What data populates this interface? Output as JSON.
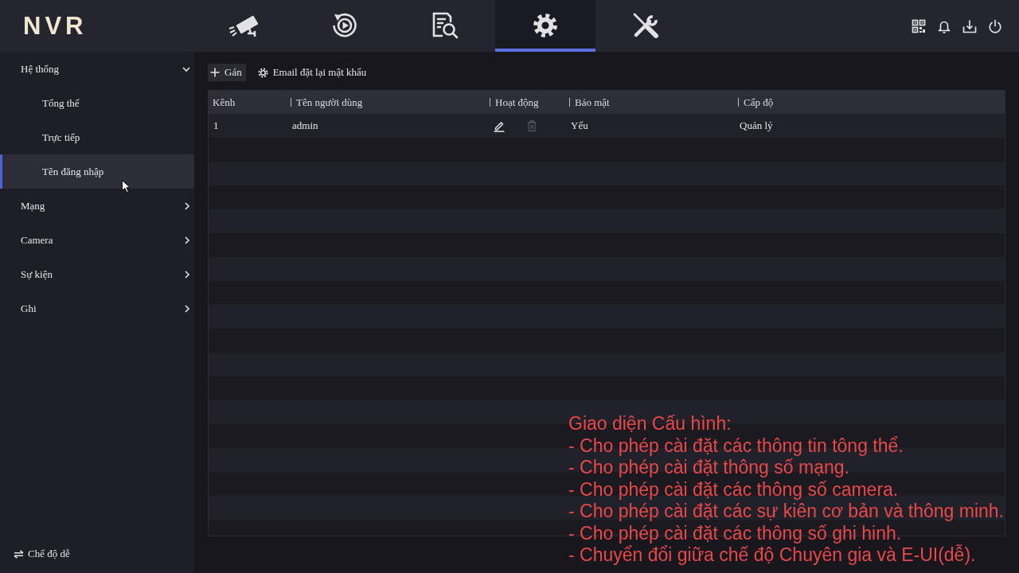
{
  "logo": "NVR",
  "nav_tabs": [
    {
      "kind": "live",
      "selected": false
    },
    {
      "kind": "playback",
      "selected": false
    },
    {
      "kind": "search",
      "selected": false
    },
    {
      "kind": "settings",
      "selected": true
    },
    {
      "kind": "maintenance",
      "selected": false
    }
  ],
  "sidebar": {
    "items": [
      {
        "label": "Hệ thống",
        "expanded": true,
        "selected": false,
        "children": [
          {
            "label": "Tổng thể",
            "selected": false
          },
          {
            "label": "Trực tiếp",
            "selected": false
          },
          {
            "label": "Tên đăng nhập",
            "selected": true
          }
        ]
      },
      {
        "label": "Mạng",
        "expanded": false,
        "selected": false
      },
      {
        "label": "Camera",
        "expanded": false,
        "selected": false
      },
      {
        "label": "Sự kiện",
        "expanded": false,
        "selected": false
      },
      {
        "label": "Ghi",
        "expanded": false,
        "selected": false
      }
    ],
    "mode_switch": "Chế độ dễ"
  },
  "toolbar": {
    "buttons": [
      {
        "kind": "add",
        "label": "Gán"
      },
      {
        "kind": "email",
        "label": "Email đặt lại mật khẩu"
      }
    ]
  },
  "table": {
    "columns": [
      "Kênh",
      "Tên người dùng",
      "Hoạt động",
      "Bảo mật",
      "Cấp độ"
    ],
    "rows": [
      {
        "channel": "1",
        "username": "admin",
        "actions": [
          {
            "kind": "edit",
            "disabled": false
          },
          {
            "kind": "delete",
            "disabled": true
          }
        ],
        "security": "Yếu",
        "role": "Quản lý"
      }
    ]
  },
  "caption": {
    "title": "Giao diện Cấu hình:",
    "lines": [
      "- Cho phép cài đặt các thông tin tông thể.",
      "- Cho phép cài đặt thông số mạng.",
      "- Cho phép cài đặt các thông số camera.",
      "- Cho phép cài đặt các sự kiên cơ bản và thông minh.",
      "- Cho phép cài đặt các thông số ghi hinh.",
      "- Chuyển đổi giữa chế độ Chuyên gia và E-UI(dễ)."
    ]
  }
}
